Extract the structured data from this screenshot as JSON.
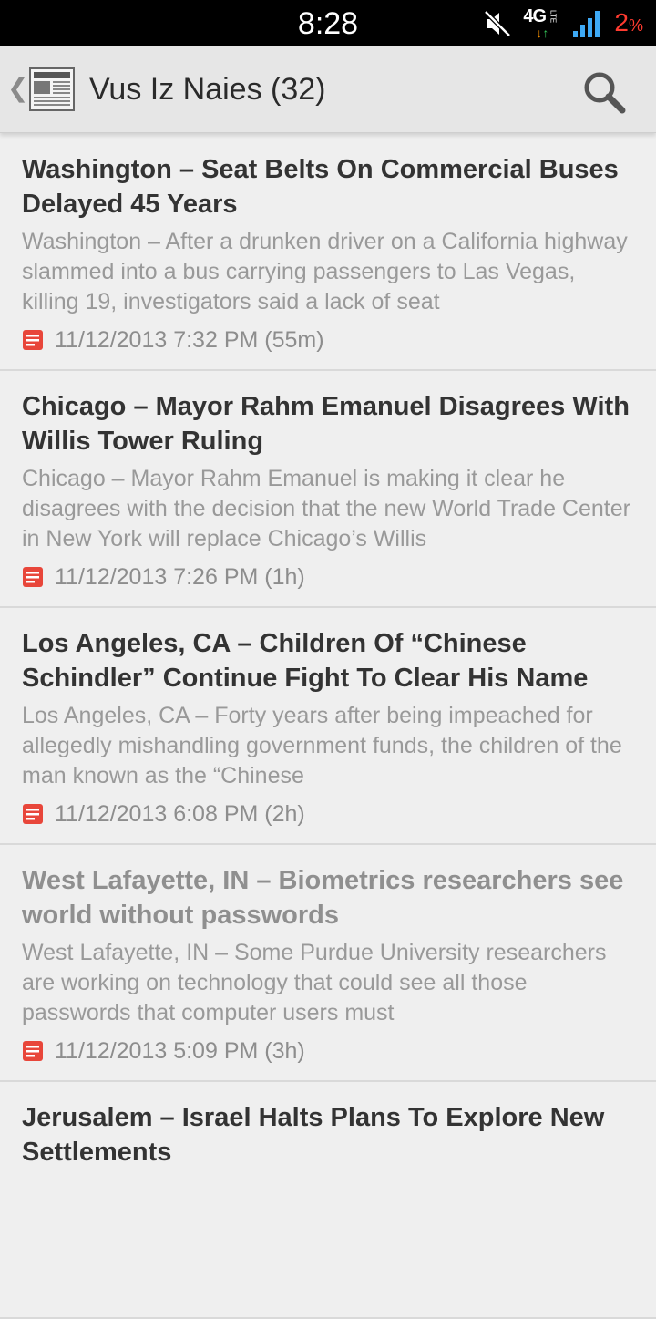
{
  "statusbar": {
    "time": "8:28",
    "network_label": "4G",
    "network_sub": "LTE",
    "battery": "2",
    "battery_unit": "%"
  },
  "actionbar": {
    "title": "Vus Iz Naies (32)",
    "up_icon": "chevron-left-icon",
    "logo_icon": "newspaper-icon",
    "search_icon": "search-icon"
  },
  "colors": {
    "accent_red": "#e8463a",
    "battery_red": "#ff3b30",
    "title_text": "#333333",
    "read_title_text": "#8f8f8f"
  },
  "articles": [
    {
      "title": "Washington – Seat Belts On Commercial Buses Delayed 45 Years",
      "snippet": "Washington – After a drunken driver on a California highway slammed into a bus carrying passengers to Las Vegas, killing 19, investigators said a lack of seat",
      "date": "11/12/2013 7:32 PM (55m)"
    },
    {
      "title": "Chicago – Mayor Rahm Emanuel Disagrees With Willis Tower Ruling",
      "snippet": "Chicago – Mayor Rahm Emanuel is making it clear he disagrees with the decision that the new World Trade Center in New York will replace Chicago’s Willis",
      "date": "11/12/2013 7:26 PM (1h)"
    },
    {
      "title": "Los Angeles, CA – Children Of “Chinese Schindler” Continue Fight To Clear His Name",
      "snippet": "Los Angeles, CA – Forty years after being impeached for allegedly mishandling government funds, the children of the man known as the “Chinese",
      "date": "11/12/2013 6:08 PM (2h)"
    },
    {
      "title": "West Lafayette, IN – Biometrics researchers see world without passwords",
      "snippet": "West Lafayette, IN – Some Purdue University researchers are working on technology that could see all those passwords that computer users must",
      "date": "11/12/2013 5:09 PM (3h)"
    },
    {
      "title": "Jerusalem – Israel Halts Plans To Explore New Settlements",
      "snippet": "",
      "date": ""
    }
  ]
}
